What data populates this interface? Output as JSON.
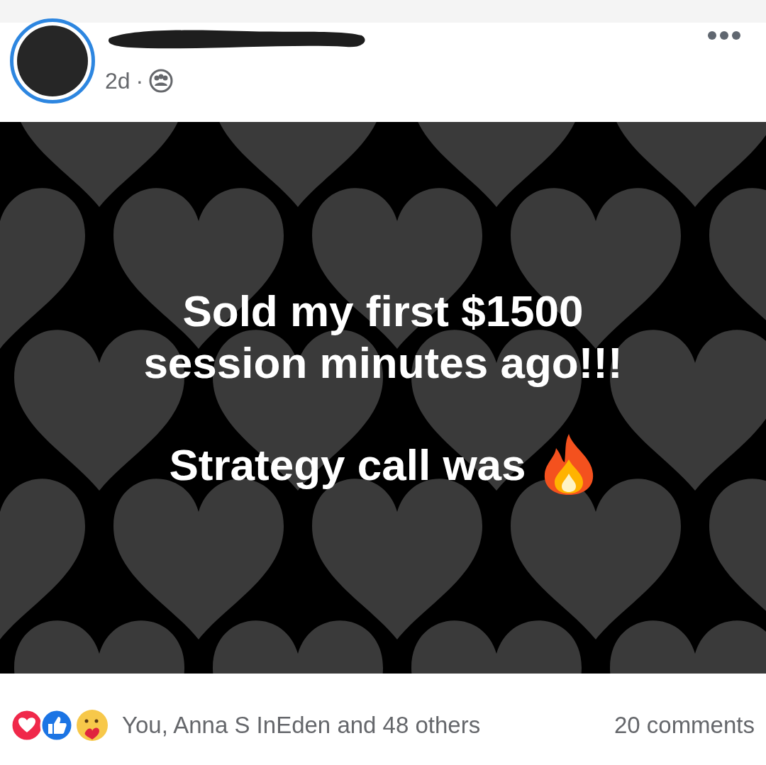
{
  "post": {
    "time": "2d",
    "separator": "·",
    "message": [
      "Sold my first $1500 session minutes ago!!!",
      "Strategy call was"
    ],
    "reactions_summary": "You, Anna S InEden and 48 others",
    "comments": "20 comments"
  }
}
